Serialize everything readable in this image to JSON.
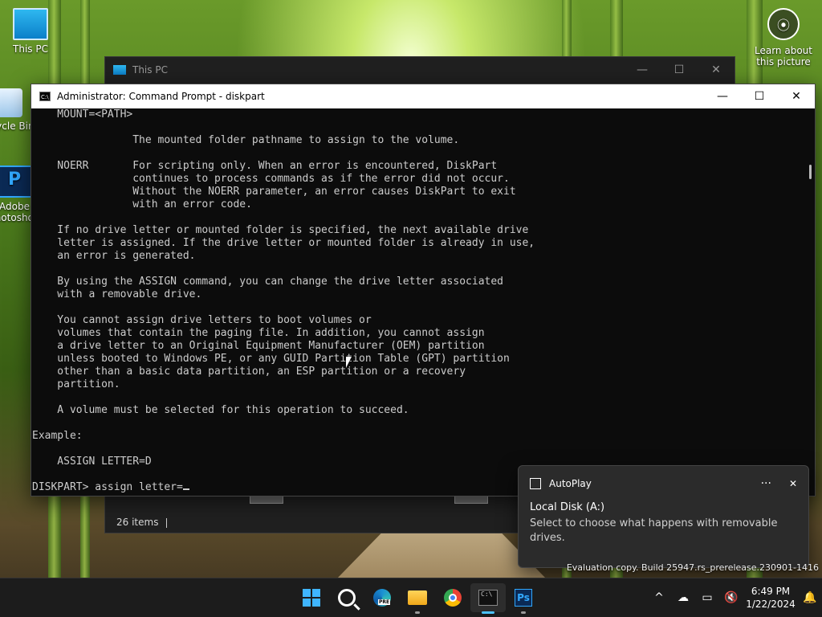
{
  "desktop": {
    "icons": [
      {
        "label": "This PC"
      },
      {
        "label": "Recycle Bin"
      },
      {
        "label": "Adobe Photoshop"
      }
    ],
    "learn_about": "Learn about this picture",
    "watermark": "Evaluation copy. Build 25947.rs_prerelease.230901-1416"
  },
  "thispc_window": {
    "title": "This PC",
    "status_items": "26 items",
    "controls": {
      "minimize": "—",
      "maximize": "☐",
      "close": "✕"
    }
  },
  "cmd_window": {
    "title": "Administrator: Command Prompt - diskpart",
    "icon_text": "C:\\",
    "controls": {
      "minimize": "—",
      "maximize": "☐",
      "close": "✕"
    },
    "lines": [
      "    MOUNT=<PATH>",
      "",
      "                The mounted folder pathname to assign to the volume.",
      "",
      "    NOERR       For scripting only. When an error is encountered, DiskPart",
      "                continues to process commands as if the error did not occur.",
      "                Without the NOERR parameter, an error causes DiskPart to exit",
      "                with an error code.",
      "",
      "    If no drive letter or mounted folder is specified, the next available drive",
      "    letter is assigned. If the drive letter or mounted folder is already in use,",
      "    an error is generated.",
      "",
      "    By using the ASSIGN command, you can change the drive letter associated",
      "    with a removable drive.",
      "",
      "    You cannot assign drive letters to boot volumes or",
      "    volumes that contain the paging file. In addition, you cannot assign",
      "    a drive letter to an Original Equipment Manufacturer (OEM) partition",
      "    unless booted to Windows PE, or any GUID Partition Table (GPT) partition",
      "    other than a basic data partition, an ESP partition or a recovery",
      "    partition.",
      "",
      "    A volume must be selected for this operation to succeed.",
      "",
      "Example:",
      "",
      "    ASSIGN LETTER=D",
      ""
    ],
    "prompt": "DISKPART> assign letter="
  },
  "toast": {
    "app_name": "AutoPlay",
    "more": "···",
    "close": "✕",
    "title": "Local Disk (A:)",
    "body": "Select to choose what happens with removable drives."
  },
  "taskbar": {
    "apps": [
      "start",
      "search",
      "edge-preview",
      "file-explorer",
      "chrome",
      "terminal",
      "photoshop"
    ],
    "edge_badge": "PRE",
    "ps_label": "Ps",
    "term_label": "C:\\",
    "tray": {
      "chevron": "^",
      "time": "6:49 PM",
      "date": "1/22/2024"
    },
    "accent": "#4cc2ff"
  }
}
